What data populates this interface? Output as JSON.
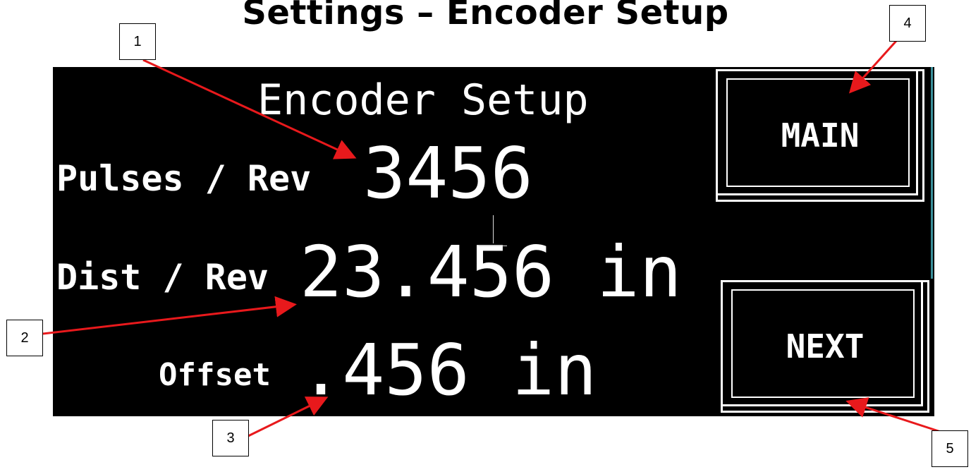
{
  "page_title": "Settings – Encoder Setup",
  "screen": {
    "title": "Encoder Setup",
    "fields": [
      {
        "label": "Pulses / Rev",
        "value": "3456"
      },
      {
        "label": "Dist / Rev",
        "value": "23.456 in"
      },
      {
        "label": "Offset",
        "value": ".456 in"
      }
    ],
    "buttons": {
      "main_label": "MAIN",
      "next_label": "NEXT"
    }
  },
  "callouts": [
    "1",
    "2",
    "3",
    "4",
    "5"
  ],
  "colors": {
    "screen_background": "#000000",
    "screen_text": "#ffffff",
    "callout_arrow": "#e8191c",
    "screen_edge": "#3a8f9a"
  }
}
